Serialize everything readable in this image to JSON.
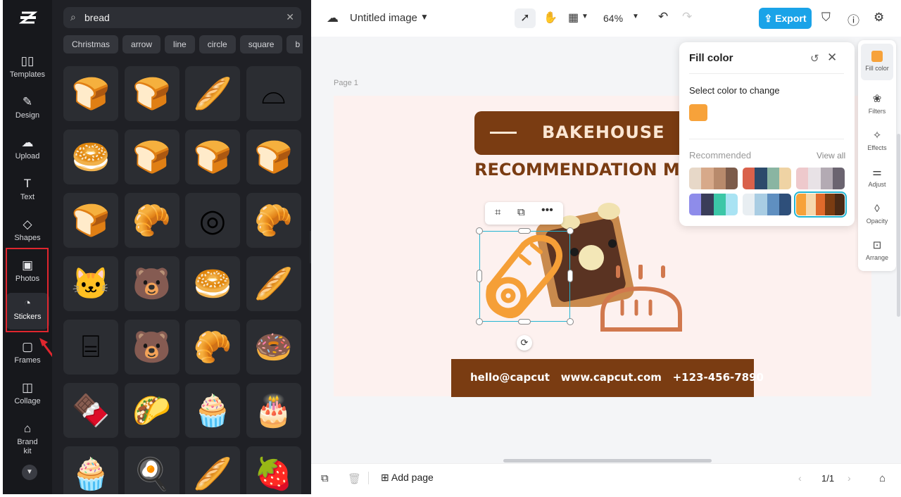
{
  "nav": {
    "items": [
      {
        "label": "Templates",
        "icon": "templates-icon"
      },
      {
        "label": "Design",
        "icon": "design-icon"
      },
      {
        "label": "Upload",
        "icon": "upload-icon"
      },
      {
        "label": "Text",
        "icon": "text-icon"
      },
      {
        "label": "Shapes",
        "icon": "shapes-icon"
      },
      {
        "label": "Photos",
        "icon": "photos-icon"
      },
      {
        "label": "Stickers",
        "icon": "stickers-icon"
      },
      {
        "label": "Frames",
        "icon": "frames-icon"
      },
      {
        "label": "Collage",
        "icon": "collage-icon"
      },
      {
        "label": "Brand kit",
        "icon": "brand-kit-icon"
      }
    ],
    "active": "Stickers"
  },
  "search": {
    "value": "bread"
  },
  "tags": [
    "Christmas",
    "arrow",
    "line",
    "circle",
    "square",
    "b"
  ],
  "stickers": [
    {
      "name": "bread-slice-sticker",
      "glyph": "🍞"
    },
    {
      "name": "sliced-loaf-sticker",
      "glyph": "🍞"
    },
    {
      "name": "baguette-sticker",
      "glyph": "🥖"
    },
    {
      "name": "bread-outline-sticker",
      "glyph": "⌓"
    },
    {
      "name": "round-loaf-sticker",
      "glyph": "🥯"
    },
    {
      "name": "rustic-loaf-sticker",
      "glyph": "🍞"
    },
    {
      "name": "white-loaf-sticker",
      "glyph": "🍞"
    },
    {
      "name": "brioche-sticker",
      "glyph": "🍞"
    },
    {
      "name": "toast-peanut-butter-sticker",
      "glyph": "🍞"
    },
    {
      "name": "chocolate-roll-sticker",
      "glyph": "🥐"
    },
    {
      "name": "swiss-roll-outline-sticker",
      "glyph": "◎"
    },
    {
      "name": "croissant-sticker",
      "glyph": "🥐"
    },
    {
      "name": "cat-toast-sticker",
      "glyph": "🐱"
    },
    {
      "name": "bear-toast-sticker",
      "glyph": "🐻"
    },
    {
      "name": "bread-rolls-sticker",
      "glyph": "🥯"
    },
    {
      "name": "baguettes-sticker",
      "glyph": "🥖"
    },
    {
      "name": "toaster-outline-sticker",
      "glyph": "⌸"
    },
    {
      "name": "bear-bread-sticker",
      "glyph": "🐻"
    },
    {
      "name": "bread-bag-sticker",
      "glyph": "🥐"
    },
    {
      "name": "donut-sticker",
      "glyph": "🍩"
    },
    {
      "name": "chocolate-plate-sticker",
      "glyph": "🍫"
    },
    {
      "name": "crepe-sticker",
      "glyph": "🌮"
    },
    {
      "name": "cream-puff-sticker",
      "glyph": "🧁"
    },
    {
      "name": "heart-cake-sticker",
      "glyph": "🎂"
    },
    {
      "name": "cupcake-sticker",
      "glyph": "🧁"
    },
    {
      "name": "egg-sticker",
      "glyph": "🍳"
    },
    {
      "name": "paper-bag-bread-sticker",
      "glyph": "🥖"
    },
    {
      "name": "raspberry-plate-sticker",
      "glyph": "🍓"
    }
  ],
  "topbar": {
    "doc_title": "Untitled image",
    "zoom": "64%",
    "export_label": "Export"
  },
  "canvas": {
    "page_label": "Page 1",
    "banner_title": "BAKEHOUSE",
    "heading": "RECOMMENDATION M",
    "footer": "hello@capcut   www.capcut.com   +123-456-7890"
  },
  "fill_color": {
    "title": "Fill color",
    "select_label": "Select color to change",
    "current_color": "#f7a23a",
    "recommended_label": "Recommended",
    "view_all": "View all",
    "palettes": [
      [
        "#e7d8c8",
        "#d7a98a",
        "#b88a6c",
        "#7c5b4a"
      ],
      [
        "#d9614b",
        "#2c4a6b",
        "#8ab5a2",
        "#efd3a4"
      ],
      [
        "#eec9cc",
        "#e8e2e6",
        "#b3aab3",
        "#6b6470"
      ],
      [
        "#8e8cea",
        "#3a3d59",
        "#3cc7a7",
        "#a9e3f3"
      ],
      [
        "#e8eef2",
        "#a9cde3",
        "#5f8fc0",
        "#2e4f7a"
      ],
      [
        "#f7a23a",
        "#f6d8ad",
        "#e06a2b",
        "#7a3c12",
        "#4a2a16"
      ]
    ]
  },
  "right_panel": [
    {
      "label": "Fill color",
      "icon": "fill-color-icon"
    },
    {
      "label": "Filters",
      "icon": "filters-icon"
    },
    {
      "label": "Effects",
      "icon": "effects-icon"
    },
    {
      "label": "Adjust",
      "icon": "adjust-icon"
    },
    {
      "label": "Opacity",
      "icon": "opacity-icon"
    },
    {
      "label": "Arrange",
      "icon": "arrange-icon"
    }
  ],
  "bottombar": {
    "add_page": "Add page",
    "page_counter": "1/1"
  },
  "colors": {
    "accent": "#1aa3e8",
    "brand_brown": "#7a3c12",
    "selection": "#23b5d3",
    "highlight_box": "#e0262e"
  }
}
